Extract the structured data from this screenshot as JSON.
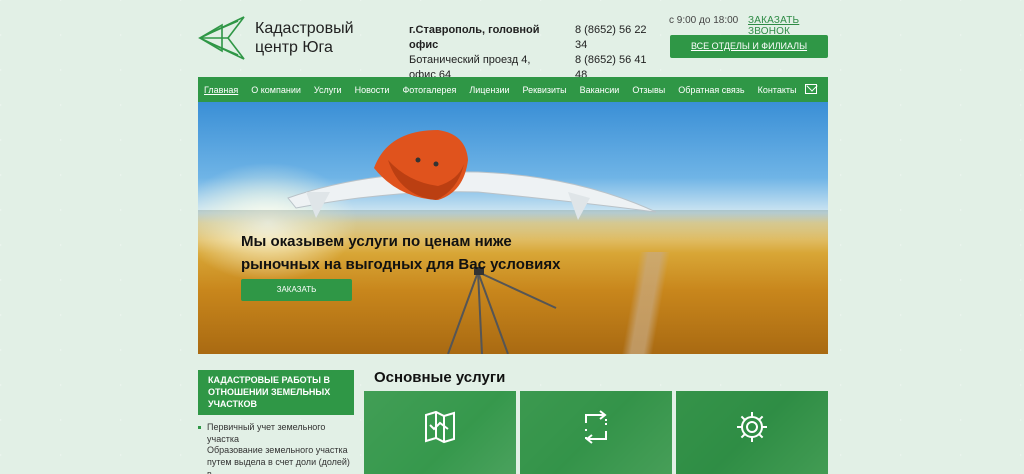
{
  "header": {
    "logo_line1": "Кадастровый",
    "logo_line2": "центр Юга",
    "office_title": "г.Ставрополь, головной офис",
    "office_address": "Ботанический проезд 4, офис 64",
    "phone1_a": "8 (8652) 56 22",
    "phone1_b": "34",
    "phone2_a": "8 (8652) 56 41",
    "phone2_b": "48",
    "hours": "с 9:00 до 18:00",
    "callback_label": "ЗАКАЗАТЬ ЗВОНОК",
    "branches_label": "ВСЕ ОТДЕЛЫ И ФИЛИАЛЫ"
  },
  "nav": {
    "items": [
      {
        "label": "Главная"
      },
      {
        "label": "О компании"
      },
      {
        "label": "Услуги"
      },
      {
        "label": "Новости"
      },
      {
        "label": "Фотогалерея"
      },
      {
        "label": "Лицензии"
      },
      {
        "label": "Реквизиты"
      },
      {
        "label": "Вакансии"
      },
      {
        "label": "Отзывы"
      },
      {
        "label": "Обратная связь"
      },
      {
        "label": "Контакты"
      }
    ],
    "mail_icon": "mail-icon"
  },
  "hero": {
    "line1": "Мы оказывем услуги по ценам ниже",
    "line2": "рыночных на выгодных для Вас условиях",
    "order_label": "ЗАКАЗАТЬ"
  },
  "sidebar": {
    "head_line1": "КАДАСТРОВЫЕ РАБОТЫ В",
    "head_line2": "ОТНОШЕНИИ ЗЕМЕЛЬНЫХ",
    "head_line3": "УЧАСТКОВ",
    "items": [
      {
        "line1": "Первичный учет земельного",
        "line2": "участка"
      },
      {
        "line1": "Образование земельного участка",
        "line2": "путем выдела в счет доли (долей) в"
      }
    ]
  },
  "services": {
    "title": "Основные услуги",
    "tiles": [
      {
        "icon": "map-icon"
      },
      {
        "icon": "transfer-icon"
      },
      {
        "icon": "gear-icon"
      }
    ]
  },
  "colors": {
    "accent": "#2f9746",
    "background": "#e2f0e6"
  }
}
